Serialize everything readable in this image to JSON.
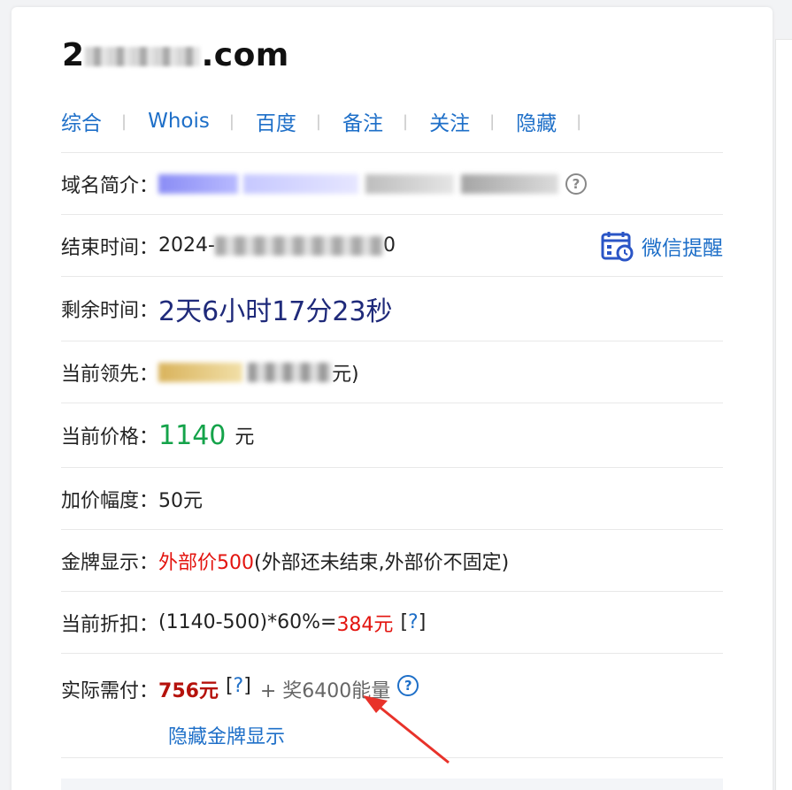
{
  "domain": {
    "visible_suffix": ".com",
    "visible_prefix": "2"
  },
  "tabs": [
    "综合",
    "Whois",
    "百度",
    "备注",
    "关注",
    "隐藏"
  ],
  "rows": {
    "intro": {
      "label": "域名简介："
    },
    "end_time": {
      "label": "结束时间：",
      "value_prefix": "2024-",
      "value_end": "0",
      "wechat_label": "微信提醒"
    },
    "remaining": {
      "label": "剩余时间：",
      "value": "2天6小时17分23秒"
    },
    "leader": {
      "label": "当前领先：",
      "value_end": "元)"
    },
    "price": {
      "label": "当前价格：",
      "value": "1140",
      "unit": "元"
    },
    "increment": {
      "label": "加价幅度：",
      "value": "50元"
    },
    "gold": {
      "label": "金牌显示：",
      "red_text": "外部价500",
      "rest_text": "(外部还未结束,外部价不固定)"
    },
    "discount": {
      "label": "当前折扣：",
      "formula": "(1140-500)*60%=",
      "result": "384元",
      "help_open": "[",
      "help_q": "?",
      "help_close": "]"
    },
    "payment": {
      "label": "实际需付：",
      "value": "756元",
      "help_open": "[",
      "help_q": "?",
      "help_close": "]",
      "bonus": "+ 奖6400能量",
      "q_icon": "?"
    },
    "hide_gold": {
      "label": "隐藏金牌显示"
    }
  },
  "colors": {
    "link": "#1e6fc8",
    "price_green": "#14a34a",
    "red": "#e3140f",
    "annotation_arrow": "#e8322a"
  }
}
